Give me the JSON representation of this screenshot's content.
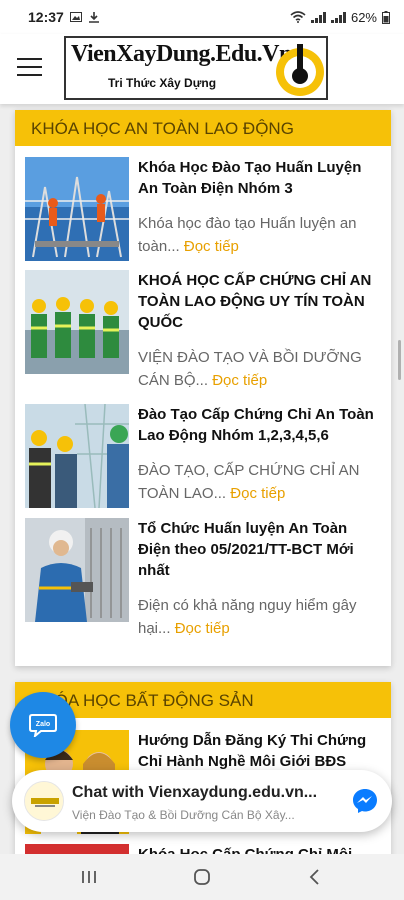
{
  "status_bar": {
    "time": "12:37",
    "battery": "62%"
  },
  "header": {
    "logo_title": "VienXayDung.Edu.Vn",
    "logo_subtitle": "Tri Thức Xây Dựng"
  },
  "sections": [
    {
      "title": "KHÓA HỌC AN TOÀN LAO ĐỘNG",
      "articles": [
        {
          "title": "Khóa Học Đào Tạo Huấn Luyện An Toàn Điện Nhóm 3",
          "excerpt": "Khóa học đào tạo Huấn luyện an toàn...",
          "read_more": "Đọc tiếp"
        },
        {
          "title": "KHOÁ HỌC CẤP CHỨNG CHỈ AN TOÀN LAO ĐỘNG UY TÍN TOÀN QUỐC",
          "excerpt": "VIỆN ĐÀO TẠO VÀ BỒI DƯỠNG CÁN BỘ...",
          "read_more": "Đọc tiếp"
        },
        {
          "title": "Đào Tạo Cấp Chứng Chỉ An Toàn Lao Động Nhóm 1,2,3,4,5,6",
          "excerpt": "ĐÀO TẠO, CẤP CHỨNG CHỈ AN TOÀN LAO...",
          "read_more": "Đọc tiếp"
        },
        {
          "title": "Tổ Chức Huấn luyện An Toàn Điện theo 05/2021/TT-BCT Mới nhất",
          "excerpt": "Điện có khả năng nguy hiểm gây hại...",
          "read_more": "Đọc tiếp"
        }
      ]
    },
    {
      "title": "KHÓA HỌC BẤT ĐỘNG SẢN",
      "articles": [
        {
          "title": "Hướng Dẫn Đăng Ký Thi Chứng Chỉ Hành Nghề Môi Giới BĐS",
          "excerpt": "",
          "read_more": ""
        },
        {
          "title": "Khóa Học Cấp Chứng Chỉ Môi",
          "excerpt": "",
          "read_more": ""
        }
      ]
    }
  ],
  "fab": {
    "label": "Zalo"
  },
  "chat": {
    "title": "Chat with Vienxaydung.edu.vn...",
    "subtitle": "Viện Đào Tạo & Bồi Dưỡng Cán Bộ Xây..."
  },
  "colors": {
    "accent_yellow": "#f6c108",
    "read_more": "#e8a000",
    "fab_blue": "#1e88e5",
    "messenger_blue": "#0a7cff"
  }
}
